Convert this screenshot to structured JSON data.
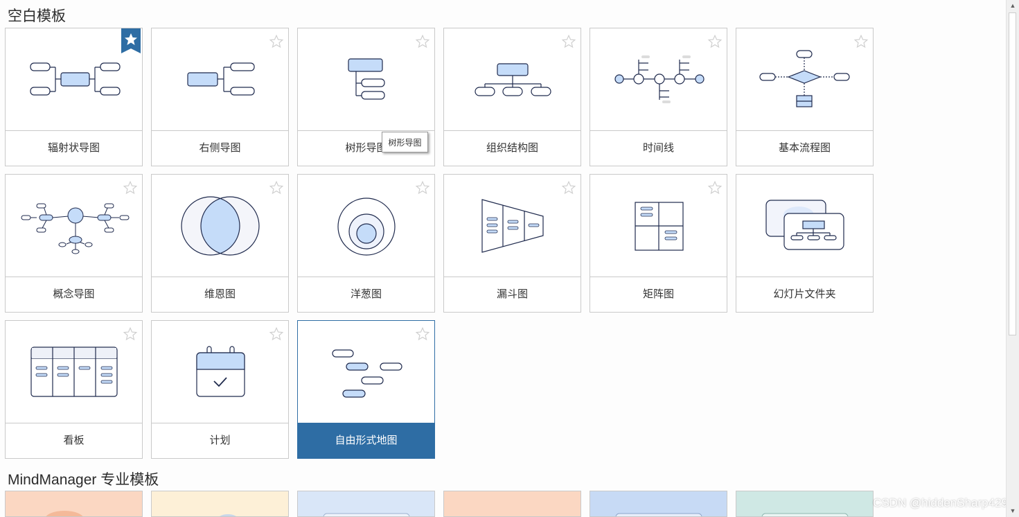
{
  "sections": {
    "blank_title": "空白模板",
    "pro_title": "MindManager 专业模板"
  },
  "templates": [
    {
      "label": "辐射状导图",
      "favorite": true
    },
    {
      "label": "右侧导图",
      "favorite": false
    },
    {
      "label": "树形导图",
      "favorite": false
    },
    {
      "label": "组织结构图",
      "favorite": false
    },
    {
      "label": "时间线",
      "favorite": false
    },
    {
      "label": "基本流程图",
      "favorite": false
    },
    {
      "label": "概念导图",
      "favorite": false
    },
    {
      "label": "维恩图",
      "favorite": false
    },
    {
      "label": "洋葱图",
      "favorite": false
    },
    {
      "label": "漏斗图",
      "favorite": false
    },
    {
      "label": "矩阵图",
      "favorite": false
    },
    {
      "label": "幻灯片文件夹",
      "favorite": false
    },
    {
      "label": "看板",
      "favorite": false
    },
    {
      "label": "计划",
      "favorite": false
    },
    {
      "label": "自由形式地图",
      "favorite": false,
      "selected": true
    }
  ],
  "tooltip": "树形导图",
  "pro_card_colors": [
    "#fbd7c2",
    "#fdf0d7",
    "#d9e6f8",
    "#fbd7c2",
    "#c7daf5",
    "#cfe8e4"
  ],
  "colors": {
    "accent": "#2e6da4",
    "node_fill": "#c5dcf9",
    "node_stroke": "#1f2a4d"
  },
  "watermark": "CSDN @hiddenSharp429"
}
